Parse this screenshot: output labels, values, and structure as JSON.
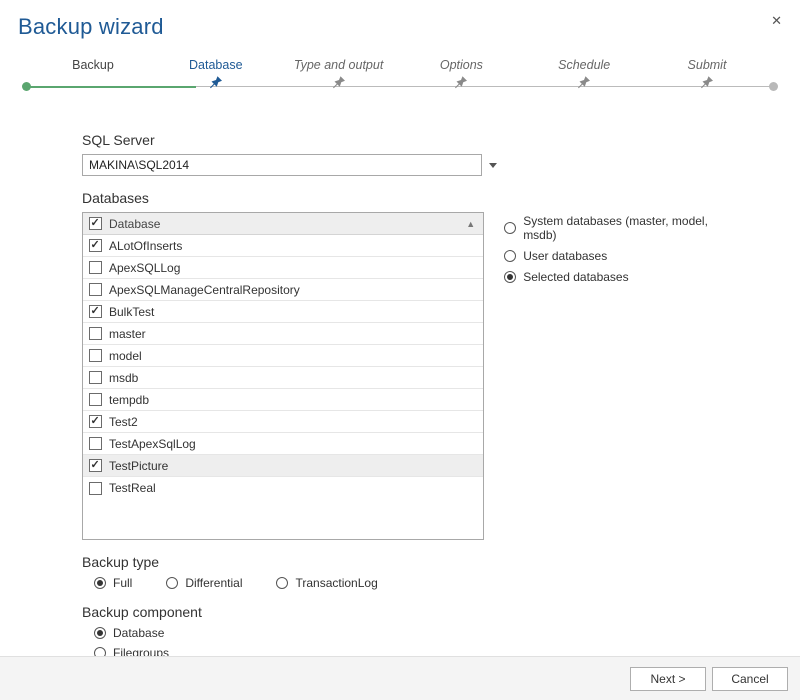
{
  "title": "Backup wizard",
  "steps": [
    {
      "label": "Backup",
      "state": "done"
    },
    {
      "label": "Database",
      "state": "active"
    },
    {
      "label": "Type and output",
      "state": "future"
    },
    {
      "label": "Options",
      "state": "future"
    },
    {
      "label": "Schedule",
      "state": "future"
    },
    {
      "label": "Submit",
      "state": "future"
    }
  ],
  "sql_server": {
    "label": "SQL Server",
    "value": "MAKINA\\SQL2014"
  },
  "databases": {
    "label": "Databases",
    "header": "Database",
    "rows": [
      {
        "name": "ALotOfInserts",
        "checked": true,
        "highlight": false
      },
      {
        "name": "ApexSQLLog",
        "checked": false,
        "highlight": false
      },
      {
        "name": "ApexSQLManageCentralRepository",
        "checked": false,
        "highlight": false
      },
      {
        "name": "BulkTest",
        "checked": true,
        "highlight": false
      },
      {
        "name": "master",
        "checked": false,
        "highlight": false
      },
      {
        "name": "model",
        "checked": false,
        "highlight": false
      },
      {
        "name": "msdb",
        "checked": false,
        "highlight": false
      },
      {
        "name": "tempdb",
        "checked": false,
        "highlight": false
      },
      {
        "name": "Test2",
        "checked": true,
        "highlight": false
      },
      {
        "name": "TestApexSqlLog",
        "checked": false,
        "highlight": false
      },
      {
        "name": "TestPicture",
        "checked": true,
        "highlight": true
      },
      {
        "name": "TestReal",
        "checked": false,
        "highlight": false
      }
    ]
  },
  "scope": {
    "options": [
      {
        "label": "System databases (master, model, msdb)",
        "selected": false
      },
      {
        "label": "User databases",
        "selected": false
      },
      {
        "label": "Selected databases",
        "selected": true
      }
    ]
  },
  "backup_type": {
    "label": "Backup type",
    "options": [
      {
        "label": "Full",
        "selected": true
      },
      {
        "label": "Differential",
        "selected": false
      },
      {
        "label": "TransactionLog",
        "selected": false
      }
    ]
  },
  "backup_component": {
    "label": "Backup component",
    "options": [
      {
        "label": "Database",
        "selected": true
      },
      {
        "label": "Filegroups",
        "selected": false
      }
    ]
  },
  "footer": {
    "next": "Next >",
    "cancel": "Cancel"
  }
}
